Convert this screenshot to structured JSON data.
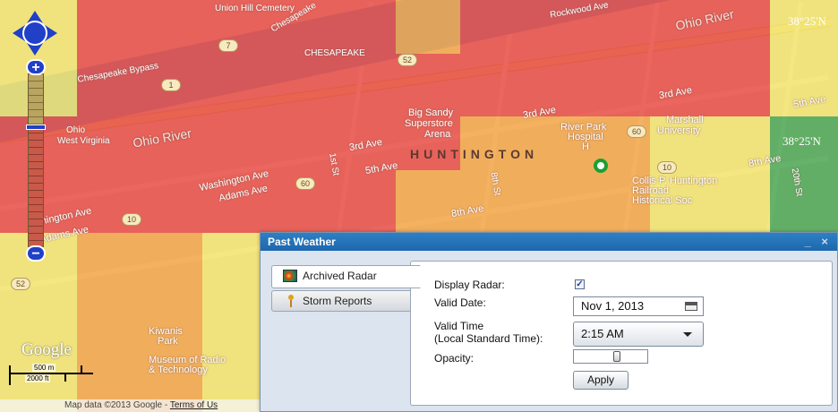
{
  "map": {
    "labels": {
      "cemetery": "Union Hill Cemetery",
      "chesapeake_diag": "Chesapeake",
      "chesapeake": "CHESAPEAKE",
      "rockwood": "Rockwood Ave",
      "ohio_river_top": "Ohio River",
      "chesapeake_bypass": "Chesapeake Bypass",
      "ohio_river_left": "Ohio River",
      "state_ohio": "Ohio",
      "state_wv": "West Virginia",
      "big_sandy": "Big Sandy",
      "superstore": "Superstore",
      "arena": "Arena",
      "third_ave_mid": "3rd Ave",
      "third_ave_right": "3rd Ave",
      "third_ave_left": "3rd Ave",
      "river_park": "River Park",
      "hospital": "Hospital",
      "hospital_h": "H",
      "marshall": "Marshall",
      "university": "University",
      "fifth_ave_right": "5th Ave",
      "fifth_ave_mid": "5th Ave",
      "huntington": "HUNTINGTON",
      "washington_ave": "Washington Ave",
      "adams_ave": "Adams Ave",
      "first_st": "1st St",
      "eighth_st": "8th St",
      "eighth_ave": "8th Ave",
      "eighth_ave_right": "8th Ave",
      "twentieth_st": "20th St",
      "collis": "Collis P. Huntington",
      "railroad": "Railroad",
      "historical": "Historical Soc",
      "washington_ave_left": "shington Ave",
      "adams_ave_left": "Adams Ave",
      "kiwanis": "Kiwanis",
      "park": "Park",
      "museum": "Museum of Radio",
      "technology": "& Technology"
    },
    "coords": {
      "top_right": "38°25'N",
      "mid_right": "38°25'N"
    },
    "shields": [
      "7",
      "52",
      "1",
      "60",
      "10",
      "60",
      "52",
      "10"
    ],
    "google_logo": "Google",
    "scale": {
      "metric": "500 m",
      "imperial": "2000 ft"
    },
    "attribution": {
      "text": "Map data ©2013 Google - ",
      "terms_link": "Terms of Us"
    },
    "zoom_in_label": "+",
    "zoom_out_label": "−"
  },
  "dialog": {
    "title": "Past Weather",
    "controls": "_ ×",
    "tabs": [
      {
        "label": "Archived Radar",
        "active": true
      },
      {
        "label": "Storm Reports",
        "active": false
      }
    ],
    "form": {
      "display_radar_label": "Display Radar:",
      "display_radar_checked": "✓",
      "valid_date_label": "Valid Date:",
      "valid_date_value": "Nov 1, 2013",
      "valid_time_label": "Valid Time",
      "valid_time_sublabel": "(Local Standard Time):",
      "valid_time_value": "2:15 AM",
      "opacity_label": "Opacity:",
      "apply_label": "Apply"
    }
  },
  "colors": {
    "radar_red": "#e5312a",
    "radar_orange": "#f29a2e",
    "radar_yellow": "#f2e35a",
    "radar_green": "#2e9a3a",
    "accent_blue": "#2040c8",
    "title_blue": "#1d67ad"
  }
}
